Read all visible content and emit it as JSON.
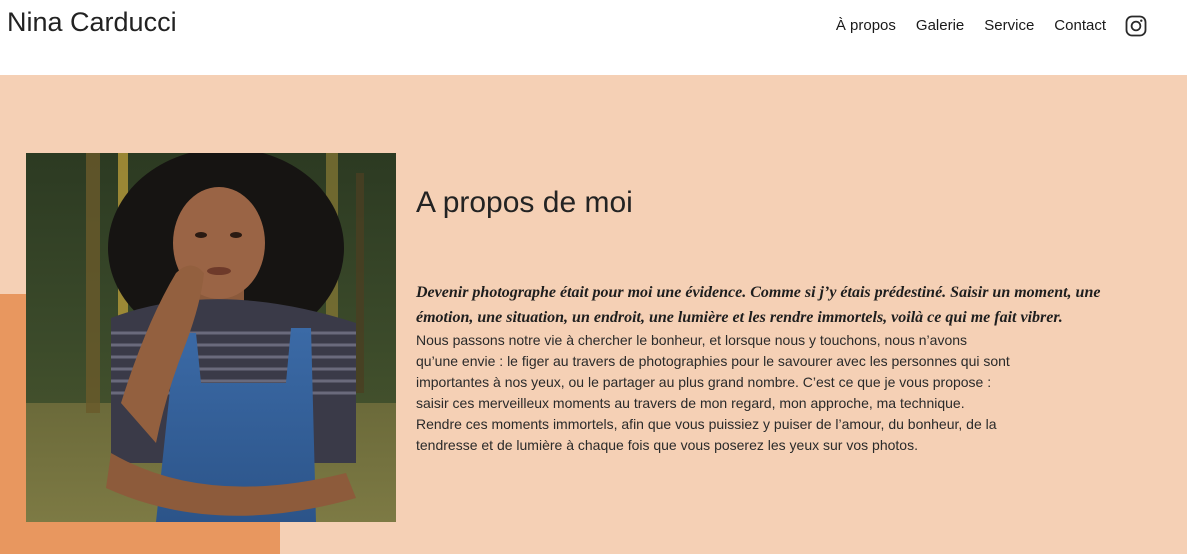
{
  "header": {
    "brand": "Nina Carducci",
    "nav": [
      {
        "label": "À propos"
      },
      {
        "label": "Galerie"
      },
      {
        "label": "Service"
      },
      {
        "label": "Contact"
      }
    ],
    "social_icon": "instagram-icon"
  },
  "about": {
    "title": "A propos de moi",
    "lead": "Devenir photographe était pour moi une évidence. Comme si j’y étais prédestiné. Saisir un moment, une émotion, une situation, un endroit, une lumière et les rendre immortels, voilà ce qui me fait vibrer.",
    "body": "Nous passons notre vie à chercher le bonheur, et lorsque nous y touchons, nous n’avons qu’une envie : le figer au travers de photographies pour le savourer avec les personnes qui sont importantes à nos yeux, ou le partager au plus grand nombre. C’est ce que je vous propose : saisir ces merveilleux moments au travers de mon regard, mon approche, ma technique. Rendre ces moments immortels, afin que vous puissiez y puiser de l’amour, du bonheur, de la tendresse et de lumière à chaque fois que vous poserez les yeux sur vos photos."
  },
  "colors": {
    "section_bg": "#f5d0b5",
    "accent": "#e8975f",
    "text": "#1f1f1f"
  }
}
